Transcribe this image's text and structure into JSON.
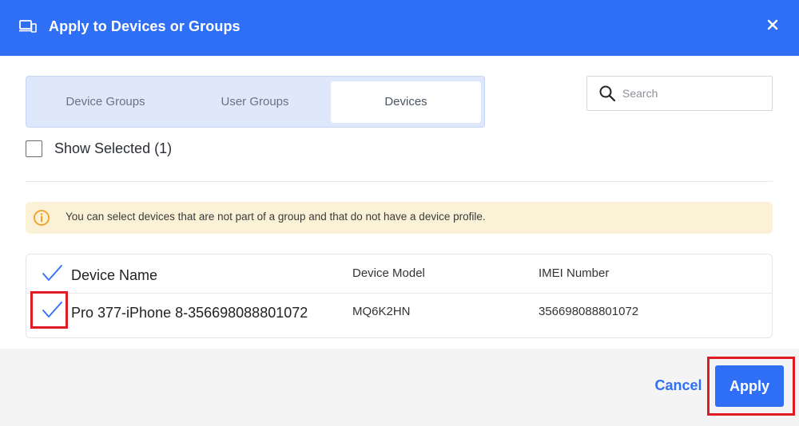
{
  "header": {
    "title": "Apply to Devices or Groups",
    "icon": "devices-icon",
    "close_icon": "close-icon",
    "background": "#2f6ff5"
  },
  "tabs": [
    {
      "label": "Device Groups",
      "active": false
    },
    {
      "label": "User Groups",
      "active": false
    },
    {
      "label": "Devices",
      "active": true
    }
  ],
  "search": {
    "placeholder": "Search",
    "value": "",
    "icon": "search-icon"
  },
  "show_selected": {
    "label": "Show Selected (1)",
    "checked": false
  },
  "alert": {
    "icon": "info-icon",
    "message": "You can select devices that are not part of a group and that do not have a device profile.",
    "background": "#fbf1d7"
  },
  "table": {
    "columns": [
      "Device Name",
      "Device Model",
      "IMEI Number"
    ],
    "header_checked": true,
    "rows": [
      {
        "checked": true,
        "name": "Pro 377-iPhone 8-356698088801072",
        "model": "MQ6K2HN",
        "imei": "356698088801072"
      }
    ]
  },
  "footer": {
    "cancel_label": "Cancel",
    "apply_label": "Apply",
    "accent": "#2f6ff5",
    "highlight": "#e01b24"
  }
}
